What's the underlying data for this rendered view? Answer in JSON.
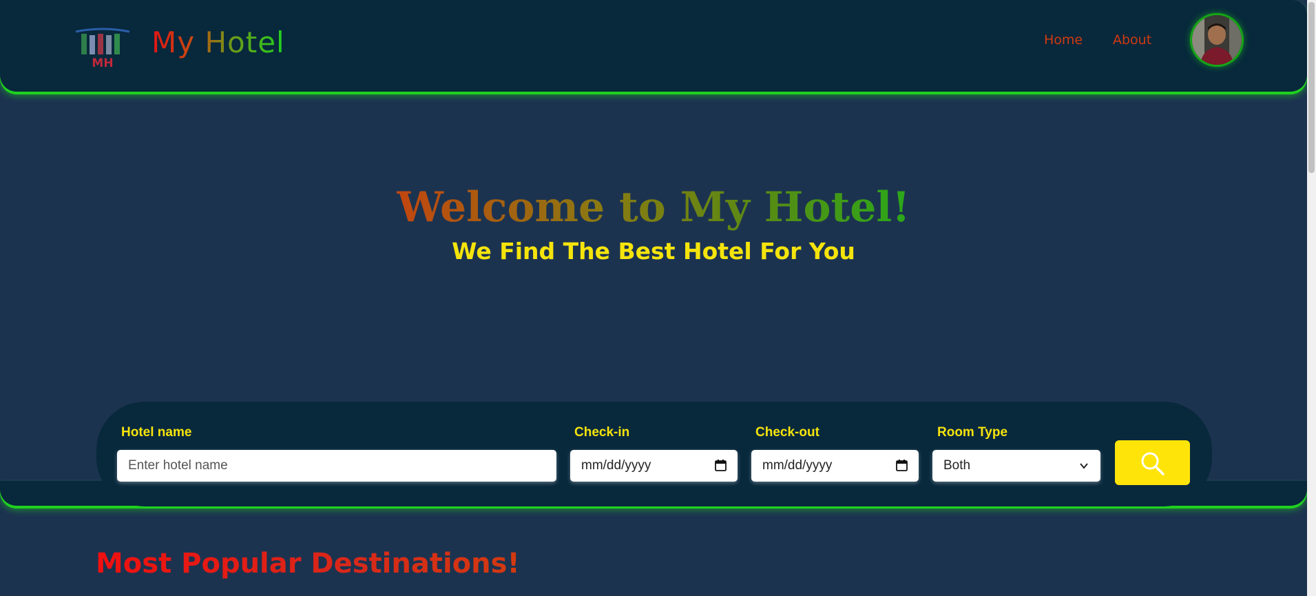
{
  "header": {
    "logo_text": "MH",
    "brand": "My Hotel",
    "nav": [
      {
        "label": "Home"
      },
      {
        "label": "About"
      }
    ]
  },
  "hero": {
    "title": "Welcome to My Hotel!",
    "subtitle": "We Find The Best Hotel For You"
  },
  "search": {
    "hotel_label": "Hotel name",
    "hotel_placeholder": "Enter hotel name",
    "checkin_label": "Check-in",
    "checkin_value": "mm/dd/yyyy",
    "checkout_label": "Check-out",
    "checkout_value": "mm/dd/yyyy",
    "room_label": "Room Type",
    "room_value": "Both",
    "button_icon": "search-icon"
  },
  "sections": {
    "popular_title": "Most Popular Destinations!"
  },
  "colors": {
    "header_bg": "#08283c",
    "page_bg": "#1c3350",
    "accent_green": "#1fd11f",
    "accent_yellow": "#f5e40c",
    "nav_color": "#d23a10"
  }
}
